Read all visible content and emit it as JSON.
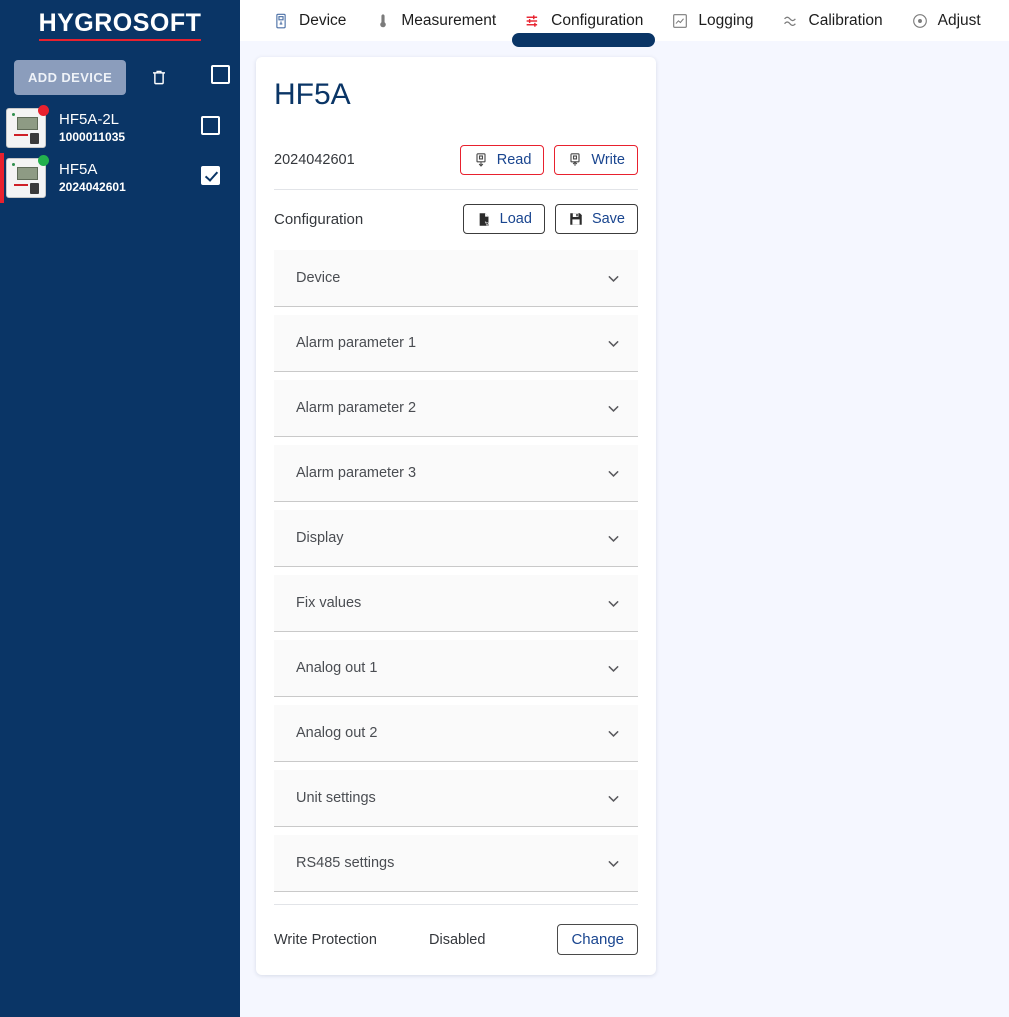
{
  "brand": {
    "name": "HYGROSOFT",
    "underline_color": "#e8212e"
  },
  "sidebar": {
    "add_device_label": "ADD DEVICE",
    "trash_icon": "trash-icon",
    "select_all_checked": false,
    "devices": [
      {
        "name": "HF5A-2L",
        "serial": "1000011035",
        "status_color": "#e8212e",
        "checked": false,
        "selected": false
      },
      {
        "name": "HF5A",
        "serial": "2024042601",
        "status_color": "#23b14d",
        "checked": true,
        "selected": true
      }
    ]
  },
  "tabs": [
    {
      "label": "Device",
      "icon": "device-meter-icon",
      "active": false
    },
    {
      "label": "Measurement",
      "icon": "thermometer-icon",
      "active": false
    },
    {
      "label": "Configuration",
      "icon": "sliders-icon",
      "active": true
    },
    {
      "label": "Logging",
      "icon": "chart-log-icon",
      "active": false
    },
    {
      "label": "Calibration",
      "icon": "wave-icon",
      "active": false
    },
    {
      "label": "Adjust",
      "icon": "target-dot-icon",
      "active": false
    }
  ],
  "card": {
    "title": "HF5A",
    "serial": "2024042601",
    "read_label": "Read",
    "write_label": "Write",
    "configuration_label": "Configuration",
    "load_label": "Load",
    "save_label": "Save",
    "sections": [
      "Device",
      "Alarm parameter 1",
      "Alarm parameter 2",
      "Alarm parameter 3",
      "Display",
      "Fix values",
      "Analog out 1",
      "Analog out 2",
      "Unit settings",
      "RS485 settings"
    ],
    "write_protection_label": "Write Protection",
    "write_protection_value": "Disabled",
    "change_label": "Change"
  },
  "colors": {
    "sidebar_bg": "#0a3566",
    "page_bg": "#f5f7ff",
    "accent_red": "#e8212e",
    "link_blue": "#19458f"
  }
}
